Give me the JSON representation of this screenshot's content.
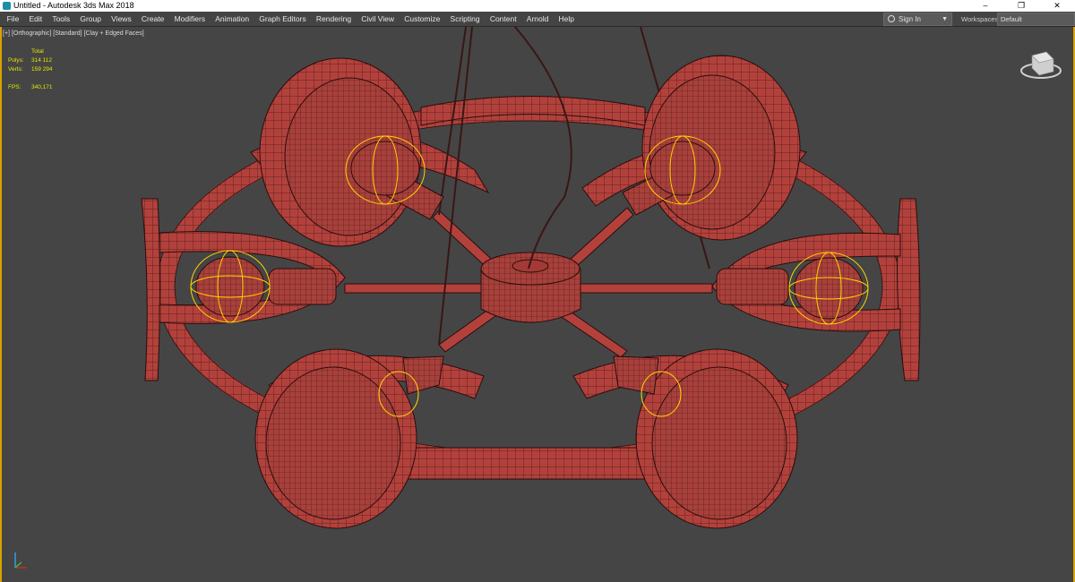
{
  "window": {
    "title": "Untitled - Autodesk 3ds Max 2018",
    "minimize": "–",
    "restore": "❐",
    "close": "✕"
  },
  "menu": [
    "File",
    "Edit",
    "Tools",
    "Group",
    "Views",
    "Create",
    "Modifiers",
    "Animation",
    "Graph Editors",
    "Rendering",
    "Civil View",
    "Customize",
    "Scripting",
    "Content",
    "Arnold",
    "Help"
  ],
  "signin": {
    "label": "Sign In",
    "arrow": "▼"
  },
  "workspaces": {
    "label": "Workspaces:",
    "value": "Default"
  },
  "viewport": {
    "labels": [
      "[+]",
      "[Orthographic]",
      "[Standard]",
      "[Clay + Edged Faces]"
    ],
    "stats": {
      "header": "Total",
      "polys_label": "Polys:",
      "polys": "314 112",
      "verts_label": "Verts:",
      "verts": "159 294",
      "fps_label": "FPS:",
      "fps": "340,171"
    }
  },
  "colors": {
    "model": "#b2413c",
    "wire": "#2a0d0c",
    "selection": "#ffd200",
    "background": "#454545",
    "border": "#d9a300"
  },
  "icons": [
    "viewcube-icon",
    "world-axis-icon",
    "app-icon"
  ]
}
